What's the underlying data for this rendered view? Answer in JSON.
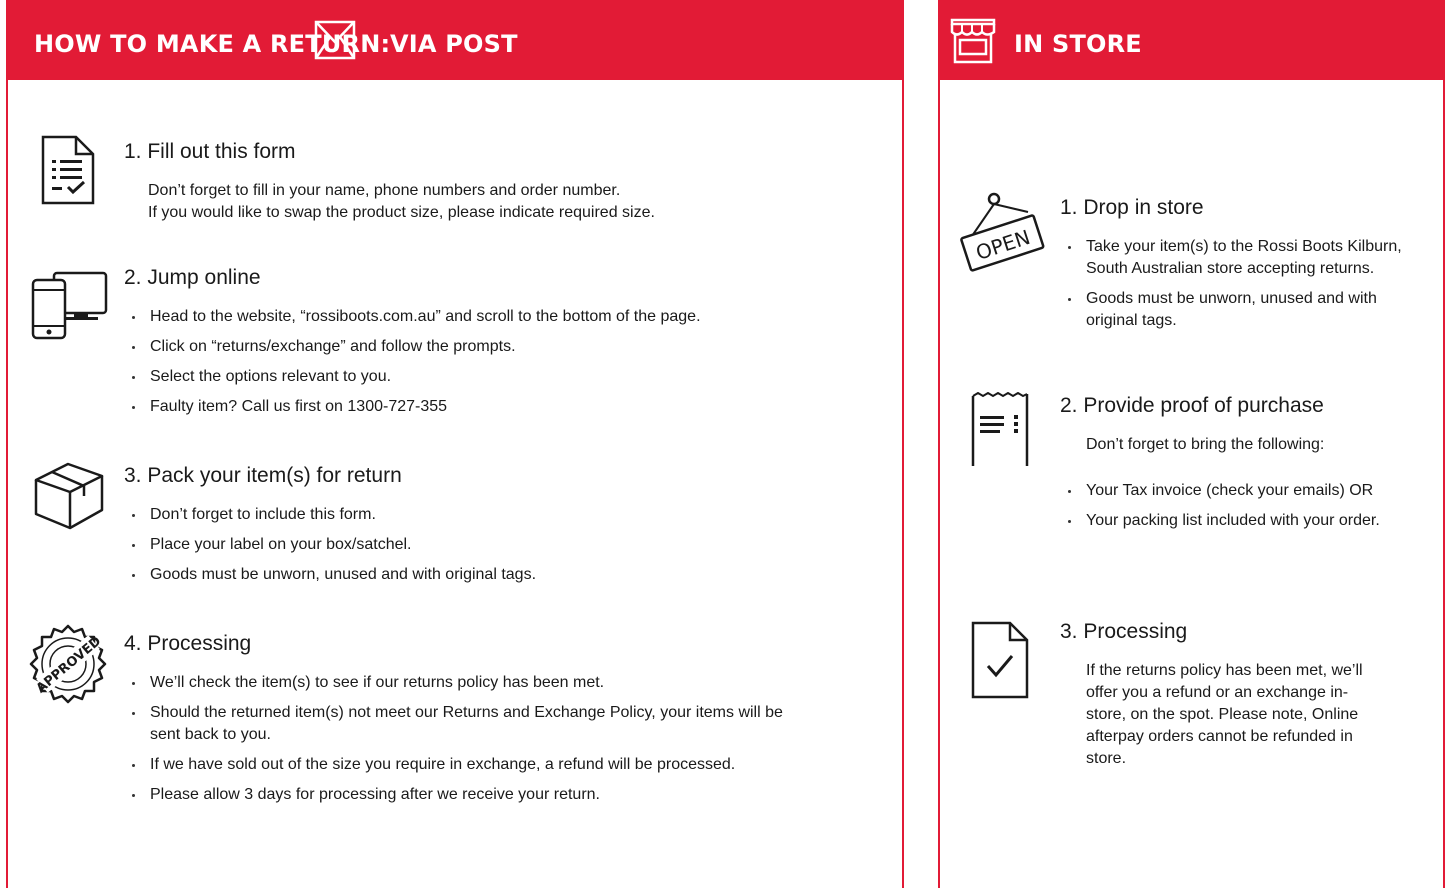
{
  "colors": {
    "brand_red": "#e21b36",
    "text": "#1a1a1a"
  },
  "post": {
    "header_title": "HOW TO MAKE A RETURN:",
    "header_icon": "envelope-icon",
    "header_subtitle": "VIA POST",
    "steps": [
      {
        "icon": "form-document-icon",
        "title": "1. Fill out this form",
        "text_lines": [
          "Don’t forget to fill in your name, phone numbers and order number.",
          "If you would like to swap the product size, please indicate required size."
        ]
      },
      {
        "icon": "devices-icon",
        "title": "2. Jump online",
        "bullets": [
          "Head to the website, “rossiboots.com.au” and scroll to the bottom of the page.",
          "Click on “returns/exchange” and follow the prompts.",
          "Select the options relevant to you.",
          "Faulty item? Call us first on 1300-727-355"
        ]
      },
      {
        "icon": "box-icon",
        "title": "3. Pack your item(s) for return",
        "bullets": [
          "Don’t forget to include this form.",
          "Place your label on your box/satchel.",
          "Goods must be unworn, unused and with original tags."
        ]
      },
      {
        "icon": "approved-stamp-icon",
        "stamp_text": "APPROVED",
        "title": "4. Processing",
        "bullets": [
          "We’ll check the item(s) to see if our returns policy has been met.",
          "Should the returned item(s) not meet our Returns and Exchange Policy, your items will be sent back to you.",
          "If we have sold out of the size you require in exchange, a refund will be processed.",
          "Please allow 3 days for processing after we receive your return."
        ]
      }
    ]
  },
  "store": {
    "header_icon": "storefront-icon",
    "header_title": "IN STORE",
    "steps": [
      {
        "icon": "open-sign-icon",
        "sign_text": "OPEN",
        "title": "1. Drop in store",
        "bullets": [
          "Take your item(s) to the Rossi Boots Kilburn, South Australian store accepting returns.",
          "Goods must be unworn, unused and with original tags."
        ]
      },
      {
        "icon": "receipt-icon",
        "title": "2. Provide proof of purchase",
        "text": "Don’t forget to bring the following:",
        "bullets": [
          "Your Tax invoice (check your emails) OR",
          "Your packing list included with your order."
        ]
      },
      {
        "icon": "checked-document-icon",
        "title": "3. Processing",
        "text": "If the returns policy has been met, we’ll offer you a refund or an exchange in-store, on the spot. Please note, Online afterpay orders cannot be refunded in store."
      }
    ]
  }
}
